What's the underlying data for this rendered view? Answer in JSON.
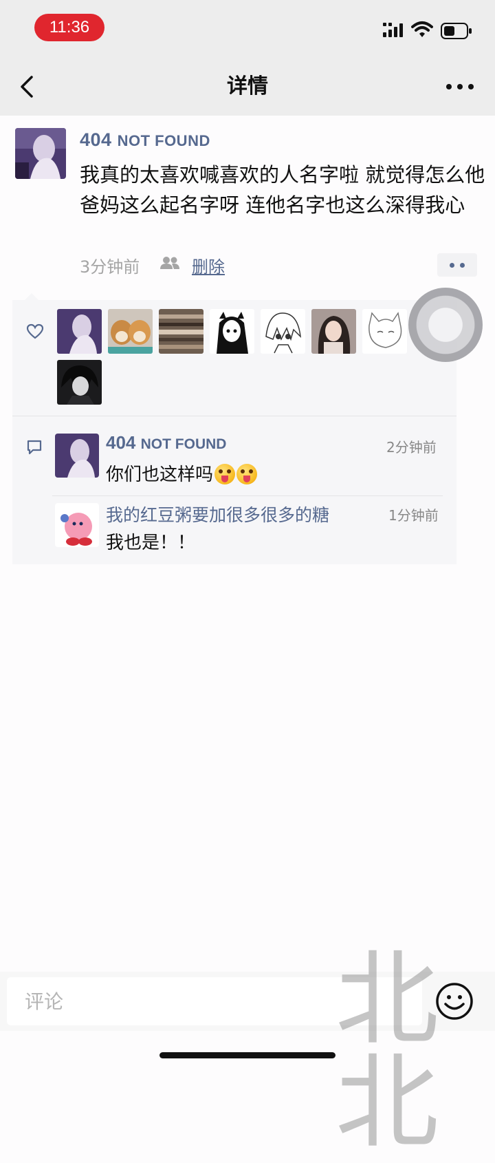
{
  "status_bar": {
    "time": "11:36"
  },
  "nav": {
    "title": "详情"
  },
  "post": {
    "author_main": "404",
    "author_small": "NOT FOUND",
    "text": "我真的太喜欢喊喜欢的人名字啦 就觉得怎么他爸妈这么起名字呀 连他名字也这么深得我心",
    "time": "3分钟前",
    "delete_label": "删除"
  },
  "comments": [
    {
      "author_main": "404",
      "author_small": "NOT FOUND",
      "time": "2分钟前",
      "text": "你们也这样吗"
    },
    {
      "author": "我的红豆粥要加很多很多的糖",
      "time": "1分钟前",
      "text": "我也是！！"
    }
  ],
  "comment_bar": {
    "placeholder": "评论"
  },
  "watermark": "北北",
  "colors": {
    "link": "#56698f",
    "status_pill": "#e0262e",
    "panel": "#f6f6f8"
  }
}
